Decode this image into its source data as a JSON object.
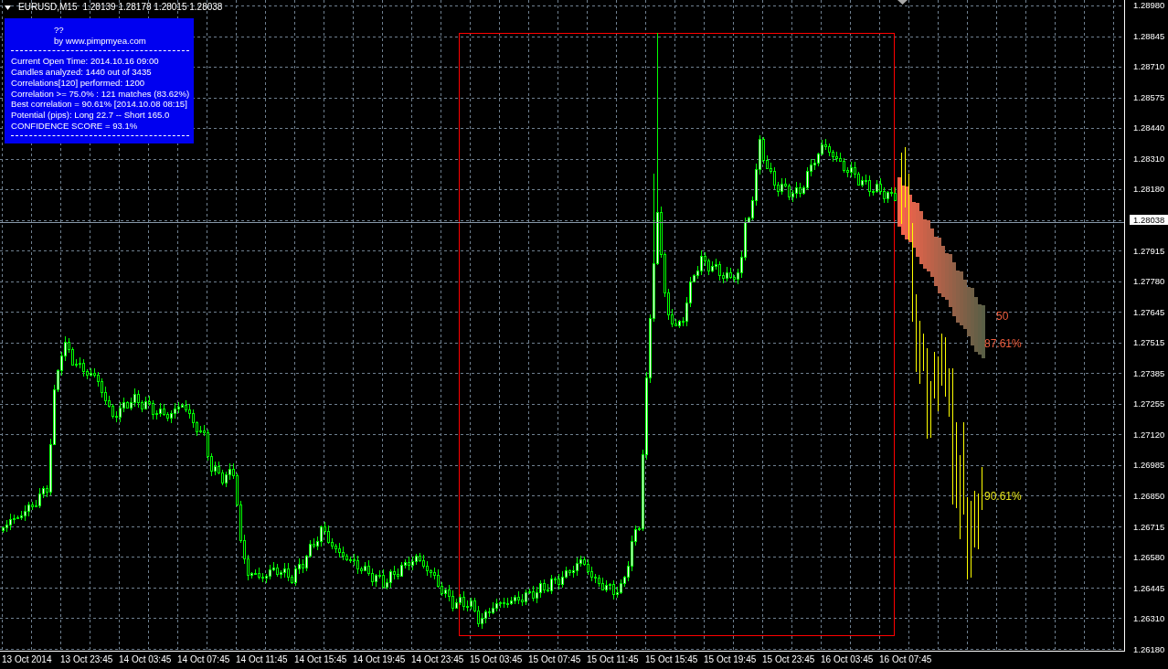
{
  "header": {
    "symbol": "EURUSD,M15",
    "prices": "1.28139 1.28178 1.28015 1.28038"
  },
  "info_panel": {
    "title": "??",
    "subtitle": "by www.pimpmyea.com",
    "lines": [
      "Current Open Time: 2014.10.16 09:00",
      "Candles analyzed: 1440 out of 3435",
      "Correlations[120] performed: 1200",
      "Correlation >= 75.0% : 121 matches (83.62%)",
      "Best correlation = 90.61% [2014.10.08 08:15]",
      "Potential (pips): Long 22.7 -- Short 165.0",
      "CONFIDENCE SCORE = 93.1%"
    ]
  },
  "forecast_labels": [
    {
      "text": "50",
      "color": "#ee5c3c"
    },
    {
      "text": "87.61%",
      "color": "#ee5c3c"
    },
    {
      "text": "90.61%",
      "color": "#e6e61e"
    }
  ],
  "price_axis": {
    "labels": [
      {
        "text": "1.28980",
        "kind": "tick"
      },
      {
        "text": "1.28845",
        "kind": "tick"
      },
      {
        "text": "1.28710",
        "kind": "tick"
      },
      {
        "text": "1.28575",
        "kind": "tick"
      },
      {
        "text": "1.28440",
        "kind": "tick"
      },
      {
        "text": "1.28310",
        "kind": "tick"
      },
      {
        "text": "1.28180",
        "kind": "tick"
      },
      {
        "text": "1.28038",
        "kind": "current"
      },
      {
        "text": "1.27915",
        "kind": "tick"
      },
      {
        "text": "1.27780",
        "kind": "tick"
      },
      {
        "text": "1.27645",
        "kind": "tick"
      },
      {
        "text": "1.27515",
        "kind": "tick"
      },
      {
        "text": "1.27385",
        "kind": "tick"
      },
      {
        "text": "1.27255",
        "kind": "tick"
      },
      {
        "text": "1.27120",
        "kind": "tick"
      },
      {
        "text": "1.26985",
        "kind": "tick"
      },
      {
        "text": "1.26850",
        "kind": "tick"
      },
      {
        "text": "1.26715",
        "kind": "tick"
      },
      {
        "text": "1.26580",
        "kind": "tick"
      },
      {
        "text": "1.26445",
        "kind": "tick"
      },
      {
        "text": "1.26310",
        "kind": "tick"
      },
      {
        "text": "1.26180",
        "kind": "tick"
      }
    ]
  },
  "time_axis": {
    "labels": [
      "13 Oct 2014",
      "13 Oct 23:45",
      "14 Oct 03:45",
      "14 Oct 07:45",
      "14 Oct 11:45",
      "14 Oct 15:45",
      "14 Oct 19:45",
      "14 Oct 23:45",
      "15 Oct 03:45",
      "15 Oct 07:45",
      "15 Oct 11:45",
      "15 Oct 15:45",
      "15 Oct 19:45",
      "15 Oct 23:45",
      "16 Oct 03:45",
      "16 Oct 07:45"
    ]
  }
}
